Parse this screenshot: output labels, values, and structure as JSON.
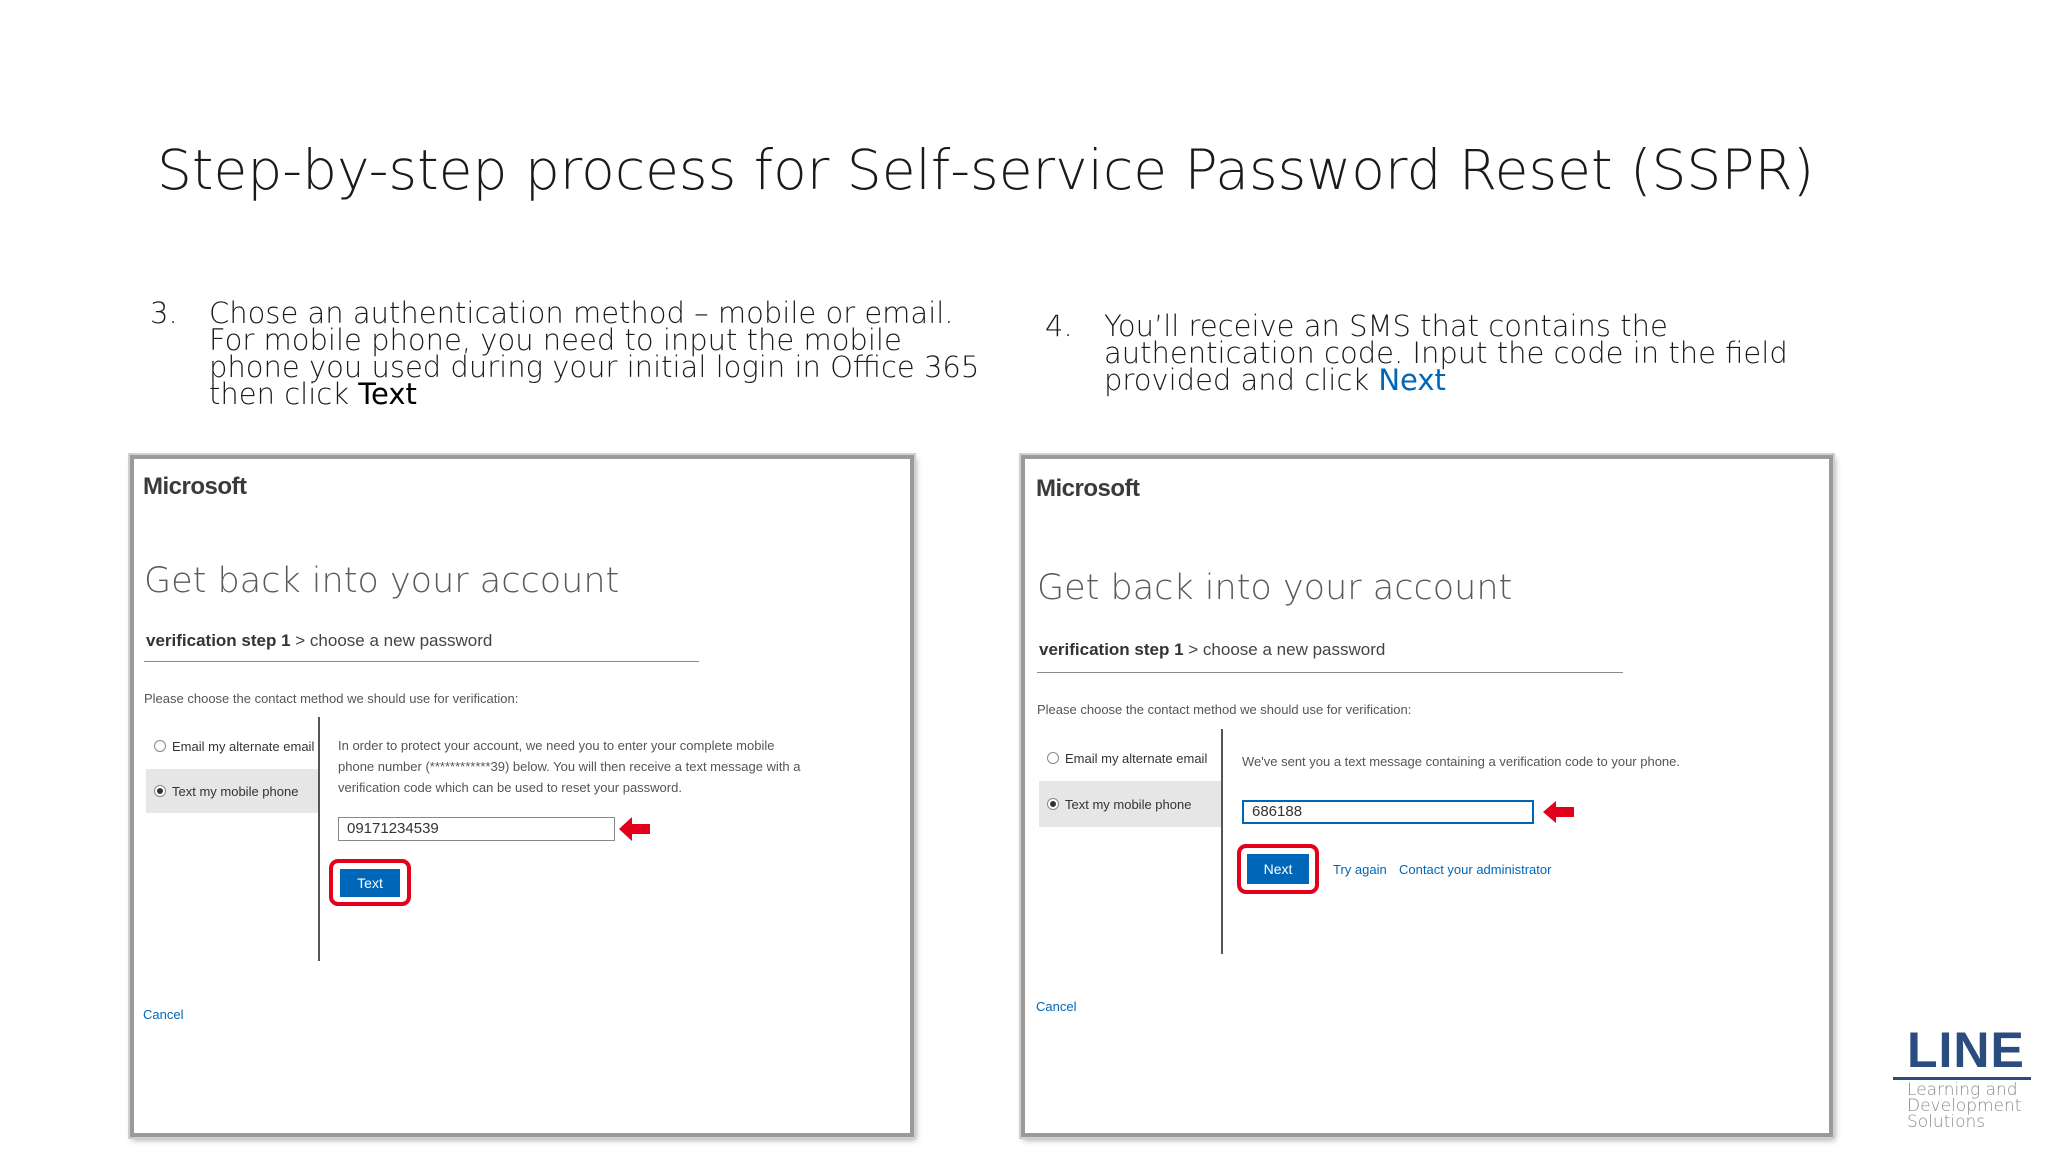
{
  "slide": {
    "title": "Step-by-step process for Self-service Password Reset (SSPR)"
  },
  "step3": {
    "number": "3.",
    "lines": [
      "Chose an authentication method – mobile or email.",
      "For mobile phone, you need to input the mobile",
      "phone you used during your initial login in Office 365"
    ],
    "last_prefix": "then click ",
    "last_highlight": "Text"
  },
  "step4": {
    "number": "4.",
    "lines": [
      "You’ll receive an SMS that contains the",
      "authentication code.  Input the code in the field"
    ],
    "last_prefix": "provided and click ",
    "last_highlight": "Next"
  },
  "screenshot1": {
    "logo": "Microsoft",
    "title": "Get back into your account",
    "steps_bold": "verification step 1",
    "steps_rest": " > choose a new password",
    "prompt": "Please choose the contact method we should use for verification:",
    "options": [
      {
        "label": "Email my alternate email",
        "selected": false
      },
      {
        "label": "Text my mobile phone",
        "selected": true
      }
    ],
    "info_lines": [
      "In order to protect your account, we need you to enter your complete mobile",
      "phone number (************39) below. You will then receive a text message with a",
      "verification code which can be used to reset your password."
    ],
    "phone_value": "09171234539",
    "text_button": "Text",
    "cancel": "Cancel"
  },
  "screenshot2": {
    "logo": "Microsoft",
    "title": "Get back into your account",
    "steps_bold": "verification step 1",
    "steps_rest": " > choose a new password",
    "prompt": "Please choose the contact method we should use for verification:",
    "options": [
      {
        "label": "Email my alternate email",
        "selected": false
      },
      {
        "label": "Text my mobile phone",
        "selected": true
      }
    ],
    "info": "We've sent you a text message containing a verification code to your phone.",
    "code_value": "686188",
    "next_button": "Next",
    "try_again": "Try again",
    "contact_admin": "Contact your administrator",
    "cancel": "Cancel"
  },
  "brand": {
    "name": "LINE",
    "sub_lines": [
      "Learning and",
      "Development",
      "Solutions"
    ],
    "color": "#2b4c7e"
  },
  "colors": {
    "ms_blue": "#0067b8",
    "highlight_red": "#e3001b"
  }
}
